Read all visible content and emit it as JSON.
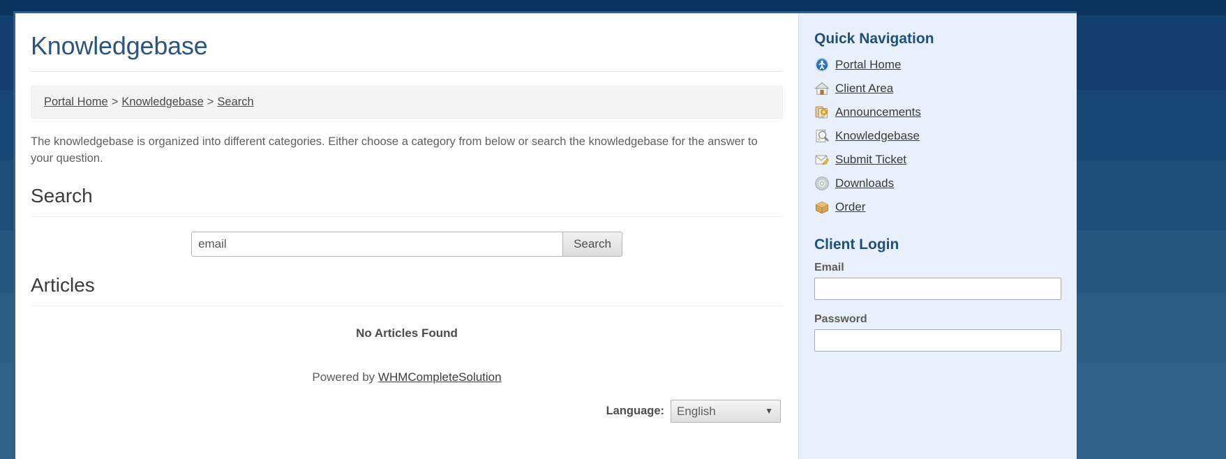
{
  "page": {
    "title": "Knowledgebase"
  },
  "breadcrumb": {
    "items": [
      "Portal Home",
      "Knowledgebase",
      "Search"
    ],
    "separator": ">"
  },
  "main": {
    "intro": "The knowledgebase is organized into different categories. Either choose a category from below or search the knowledgebase for the answer to your question.",
    "search_heading": "Search",
    "search_value": "email",
    "search_placeholder": "",
    "search_button": "Search",
    "articles_heading": "Articles",
    "no_articles": "No Articles Found"
  },
  "footer": {
    "powered_prefix": "Powered by",
    "powered_link": "WHMCompleteSolution",
    "language_label": "Language:",
    "language_value": "English",
    "language_caret": "▼"
  },
  "sidebar": {
    "quick_nav_heading": "Quick Navigation",
    "nav_items": [
      {
        "label": "Portal Home",
        "icon": "portal-home-icon"
      },
      {
        "label": "Client Area",
        "icon": "house-icon"
      },
      {
        "label": "Announcements",
        "icon": "announcements-icon"
      },
      {
        "label": "Knowledgebase",
        "icon": "magnifier-document-icon"
      },
      {
        "label": "Submit Ticket",
        "icon": "envelope-pencil-icon"
      },
      {
        "label": "Downloads",
        "icon": "disc-icon"
      },
      {
        "label": "Order",
        "icon": "package-box-icon"
      }
    ],
    "login_heading": "Client Login",
    "email_label": "Email",
    "email_value": "",
    "password_label": "Password",
    "password_value": ""
  },
  "colors": {
    "page_background": "#1c4d79",
    "frame_border": "#2e5f8e",
    "title_blue": "#2a5580",
    "sidebar_background": "#e8f0fb",
    "sidebar_heading": "#1d4f7f",
    "breadcrumb_background": "#f4f4f4"
  }
}
